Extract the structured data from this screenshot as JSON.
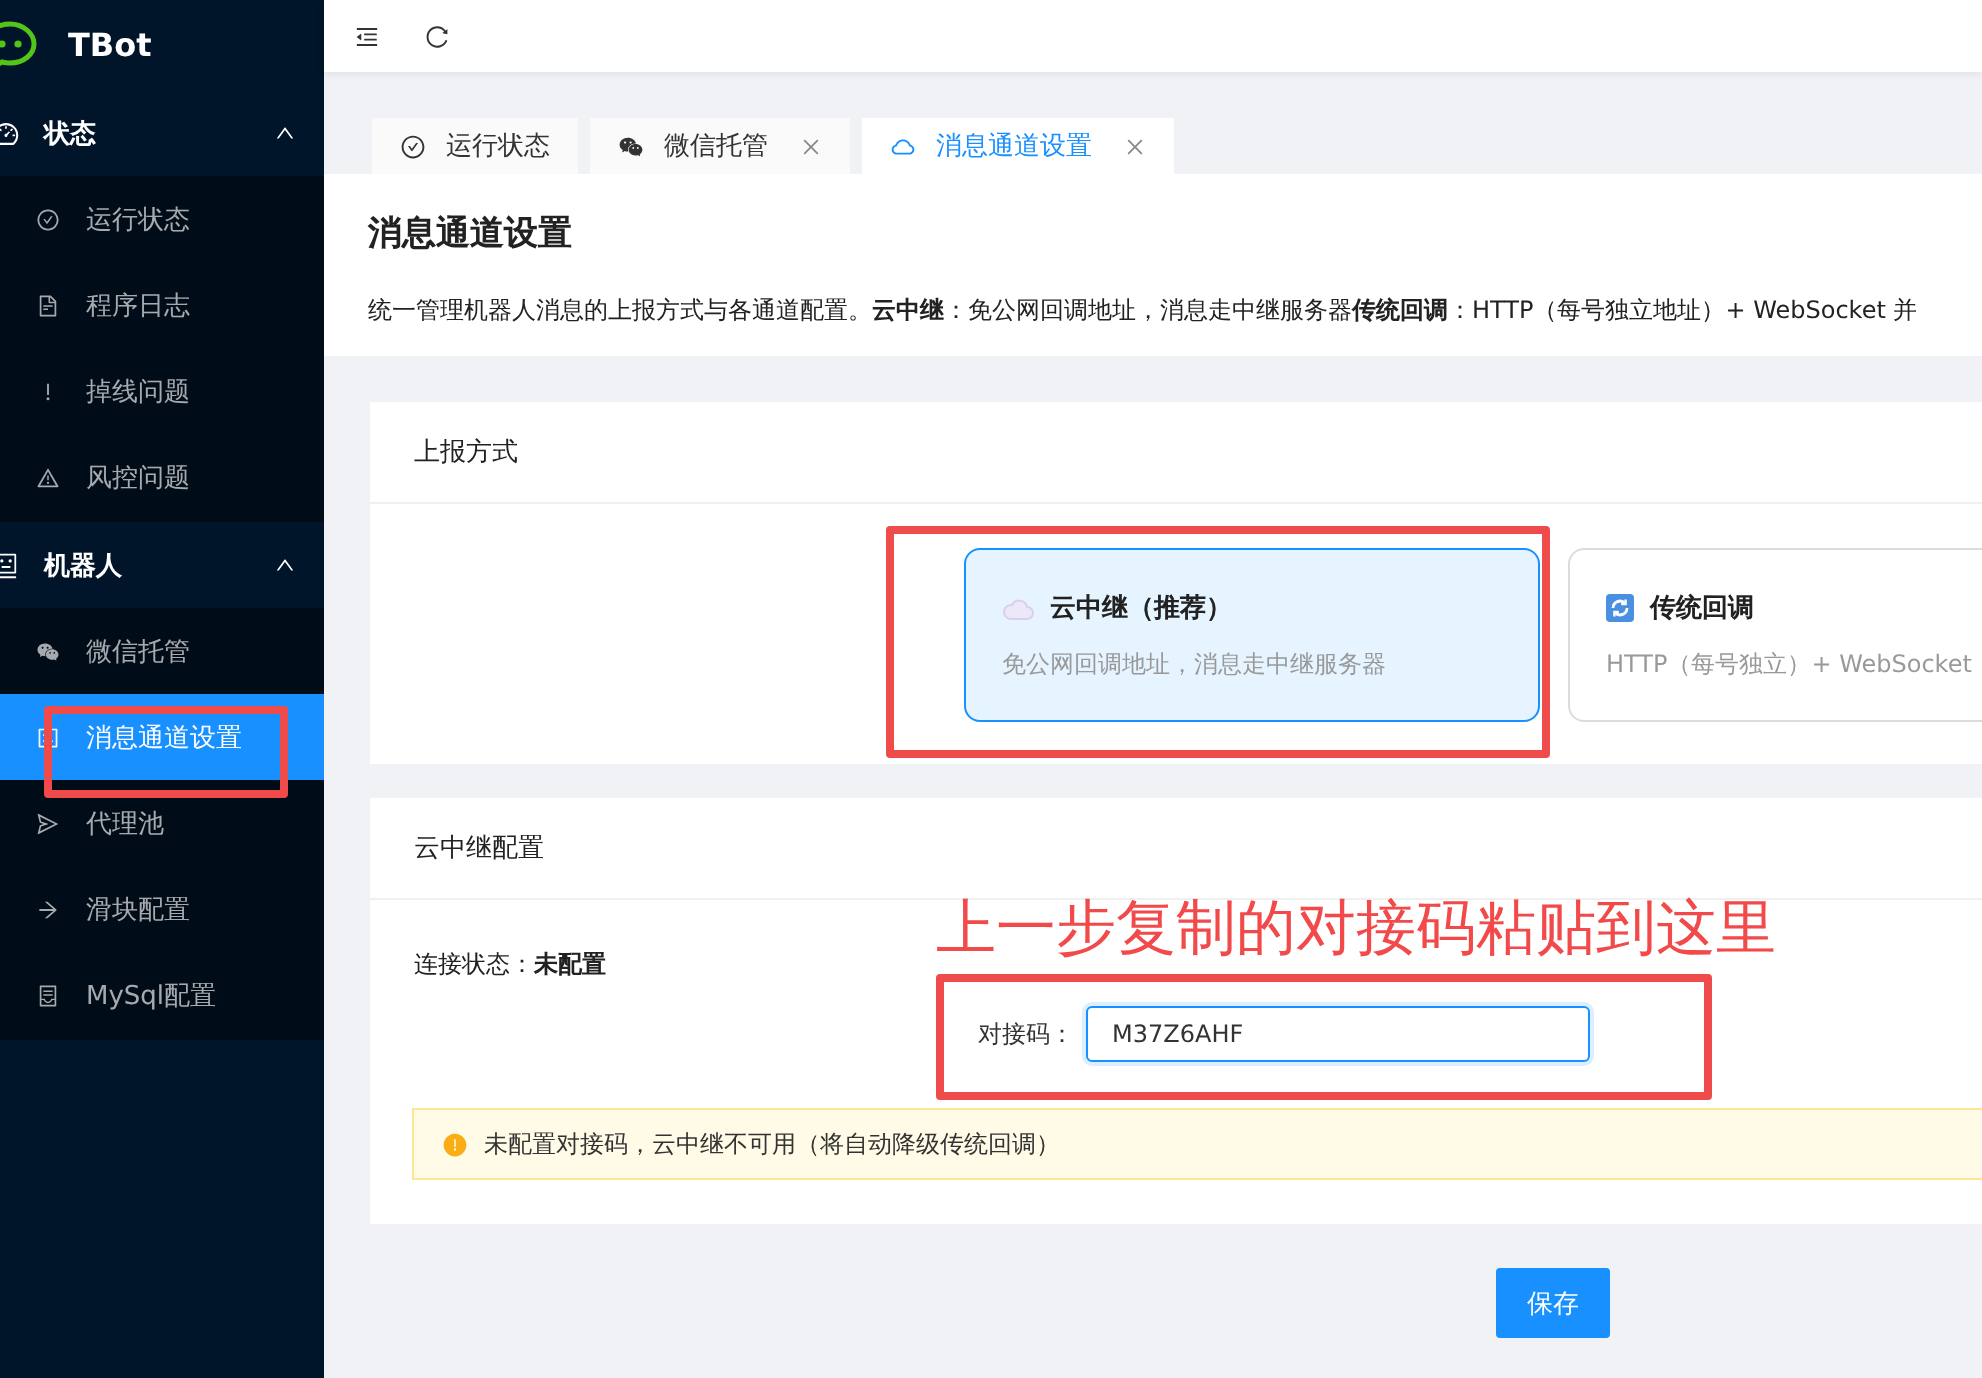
{
  "sidebar": {
    "brand": "TBot",
    "groups": [
      {
        "label": "状态",
        "expanded": true,
        "items": [
          {
            "label": "运行状态",
            "selected": false
          },
          {
            "label": "程序日志",
            "selected": false
          },
          {
            "label": "掉线问题",
            "selected": false
          },
          {
            "label": "风控问题",
            "selected": false
          }
        ]
      },
      {
        "label": "机器人",
        "expanded": true,
        "items": [
          {
            "label": "微信托管",
            "selected": false
          },
          {
            "label": "消息通道设置",
            "selected": true
          },
          {
            "label": "代理池",
            "selected": false
          },
          {
            "label": "滑块配置",
            "selected": false
          },
          {
            "label": "MySql配置",
            "selected": false
          }
        ]
      }
    ]
  },
  "tabs": [
    {
      "label": "运行状态",
      "selected": false,
      "closable": false
    },
    {
      "label": "微信托管",
      "selected": false,
      "closable": true
    },
    {
      "label": "消息通道设置",
      "selected": true,
      "closable": true
    }
  ],
  "page_header": {
    "title": "消息通道设置",
    "description": "统一管理机器人消息的上报方式与各通道配置。**云中继**：免公网回调地址，消息走中继服务器**传统回调**：HTTP（每号独立地址）+ WebSocket 并"
  },
  "report_mode": {
    "title": "上报方式",
    "options": [
      {
        "title": "云中继（推荐）",
        "description": "免公网回调地址，消息走中继服务器",
        "selected": true
      },
      {
        "title": "传统回调",
        "description": "HTTP（每号独立）+ WebSocket",
        "selected": false
      }
    ]
  },
  "relay_config": {
    "title": "云中继配置",
    "status_label": "连接状态：",
    "status_value": "未配置",
    "code_label": "对接码：",
    "code_value": "M37Z6AHF",
    "alert": "未配置对接码，云中继不可用（将自动降级传统回调）"
  },
  "save_button": "保存",
  "annotation": {
    "caption": "上一步复制的对接码粘贴到这里"
  }
}
